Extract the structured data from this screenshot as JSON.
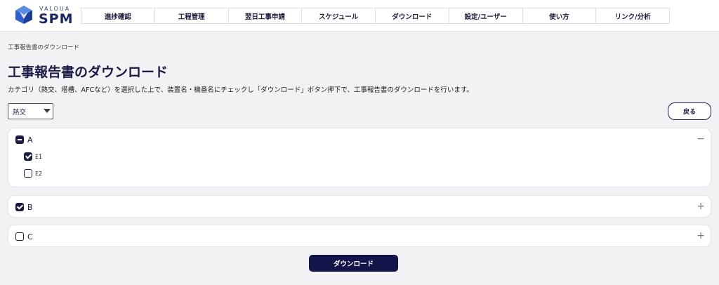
{
  "brand": {
    "top": "VALOUA",
    "main": "SPM"
  },
  "nav": [
    {
      "label": "進捗確認"
    },
    {
      "label": "工程管理"
    },
    {
      "label": "翌日工事申請"
    },
    {
      "label": "スケジュール"
    },
    {
      "label": "ダウンロード"
    },
    {
      "label": "設定/ユーザー"
    },
    {
      "label": "使い方"
    },
    {
      "label": "リンク/分析"
    }
  ],
  "breadcrumb": "工事報告書のダウンロード",
  "page_title": "工事報告書のダウンロード",
  "description": "カテゴリ（熱交、塔槽、AFCなど）を選択した上で、装置名・機番名にチェックし「ダウンロード」ボタン押下で、工事報告書のダウンロードを行います。",
  "category_select": {
    "value": "熱交"
  },
  "back_label": "戻る",
  "groups": [
    {
      "label": "A",
      "state": "indeterminate",
      "toggle": "−",
      "items": [
        {
          "label": "E1",
          "checked": true
        },
        {
          "label": "E2",
          "checked": false
        }
      ]
    },
    {
      "label": "B",
      "state": "checked",
      "toggle": "+"
    },
    {
      "label": "C",
      "state": "unchecked",
      "toggle": "+"
    }
  ],
  "download_label": "ダウンロード",
  "colors": {
    "primary": "#14134a",
    "background": "#f2f2f4",
    "logo_accent": "#3b6fd0"
  }
}
